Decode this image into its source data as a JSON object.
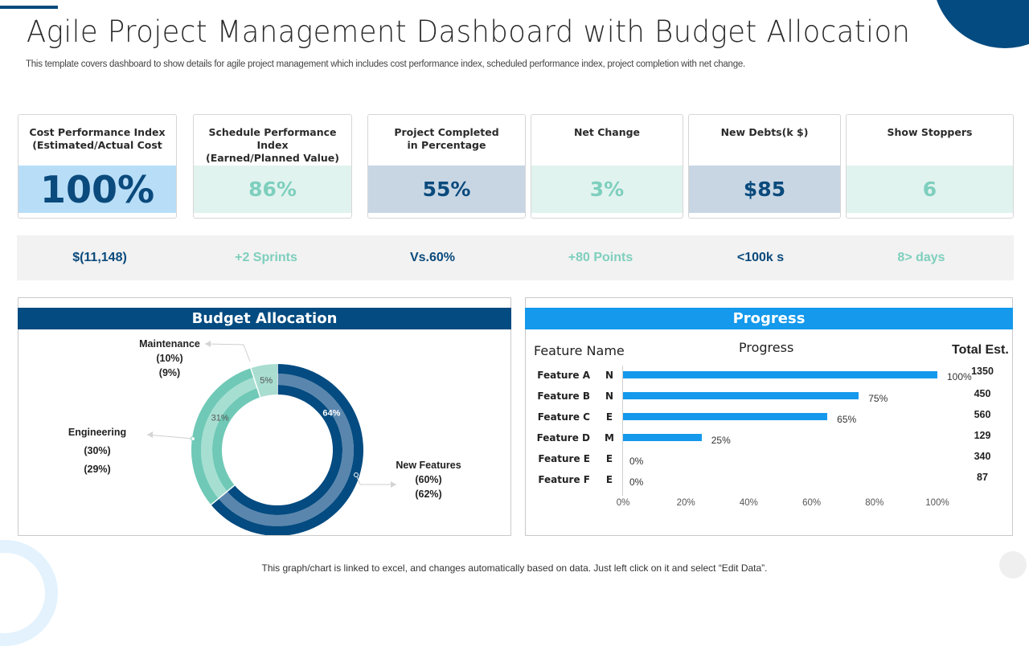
{
  "header": {
    "title": "Agile Project Management Dashboard with Budget Allocation",
    "subtitle": "This template covers dashboard to show details for agile project management which includes cost performance index, scheduled performance index, project completion with net change."
  },
  "colors": {
    "navy": "#034b80",
    "bright_blue": "#1499ec",
    "mint": "#7ecfbd",
    "light_blue_band": "#b8ddf7",
    "mint_band": "#e1f3ef",
    "slate_band": "#c8d6e4",
    "strip_bg": "#f2f2f2"
  },
  "kpis": [
    {
      "label_line1": "Cost Performance Index",
      "label_line2": "(Estimated/Actual Cost",
      "value": "100%"
    },
    {
      "label_line1": "Schedule Performance Index",
      "label_line2": "(Earned/Planned Value)",
      "value": "86%"
    },
    {
      "label_line1": "Project Completed",
      "label_line2": "in Percentage",
      "value": "55%"
    },
    {
      "label_line1": "Net Change",
      "label_line2": "",
      "value": "3%"
    },
    {
      "label_line1": "New Debts(k $)",
      "label_line2": "",
      "value": "$85"
    },
    {
      "label_line1": "Show Stoppers",
      "label_line2": "",
      "value": "6"
    }
  ],
  "stats": [
    "$(11,148)",
    "+2 Sprints",
    "Vs.60%",
    "+80 Points",
    "<100k s",
    "8> days"
  ],
  "budget": {
    "title": "Budget Allocation"
  },
  "progress_panel": {
    "title": "Progress",
    "col_feature": "Feature Name",
    "col_progress": "Progress",
    "col_total": "Total Est."
  },
  "footer": {
    "note": "This graph/chart is linked to excel, and changes automatically based on data. Just left click on it and select “Edit Data”."
  },
  "chart_data": [
    {
      "type": "pie",
      "title": "Budget Allocation",
      "style": "donut",
      "categories": [
        "Maintenance",
        "Engineering",
        "New Features"
      ],
      "values": [
        5,
        31,
        64
      ],
      "value_labels": [
        "5%",
        "31%",
        "64%"
      ],
      "annotations": [
        {
          "category": "Maintenance",
          "line1": "(10%)",
          "line2": "(9%)"
        },
        {
          "category": "Engineering",
          "line1": "(30%)",
          "line2": "(29%)"
        },
        {
          "category": "New Features",
          "line1": "(60%)",
          "line2": "(62%)"
        }
      ]
    },
    {
      "type": "bar",
      "orientation": "horizontal",
      "title": "Progress",
      "categories": [
        "Feature A",
        "Feature B",
        "Feature C",
        "Feature D",
        "Feature E",
        "Feature F"
      ],
      "codes": [
        "N",
        "N",
        "E",
        "M",
        "E",
        "E"
      ],
      "values": [
        100,
        75,
        65,
        25,
        0,
        0
      ],
      "value_labels": [
        "100%",
        "75%",
        "65%",
        "25%",
        "0%",
        "0%"
      ],
      "total_est": [
        1350,
        450,
        560,
        129,
        340,
        87
      ],
      "xlim": [
        0,
        100
      ],
      "x_ticks": [
        "0%",
        "20%",
        "40%",
        "60%",
        "80%",
        "100%"
      ],
      "grid": false
    }
  ]
}
